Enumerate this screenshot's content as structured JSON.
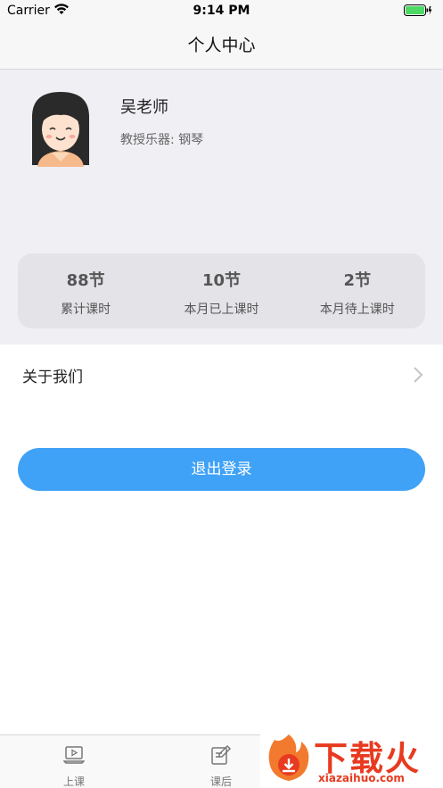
{
  "status_bar": {
    "carrier": "Carrier",
    "time": "9:14 PM"
  },
  "nav": {
    "title": "个人中心"
  },
  "profile": {
    "name": "吴老师",
    "instrument": "教授乐器: 钢琴",
    "stats": [
      {
        "value": "88节",
        "label": "累计课时"
      },
      {
        "value": "10节",
        "label": "本月已上课时"
      },
      {
        "value": "2节",
        "label": "本月待上课时"
      }
    ]
  },
  "menu": {
    "about": "关于我们"
  },
  "actions": {
    "logout": "退出登录"
  },
  "tabs": [
    {
      "label": "上课",
      "icon": "laptop-play-icon"
    },
    {
      "label": "课后",
      "icon": "edit-note-icon"
    }
  ],
  "watermark": {
    "text": "下载火",
    "url": "xiazaihuo.com"
  },
  "colors": {
    "accent": "#3fa2f7",
    "profile_bg": "#efeff4",
    "stats_bg": "#e3e3e8",
    "watermark": "#e83a1f"
  }
}
